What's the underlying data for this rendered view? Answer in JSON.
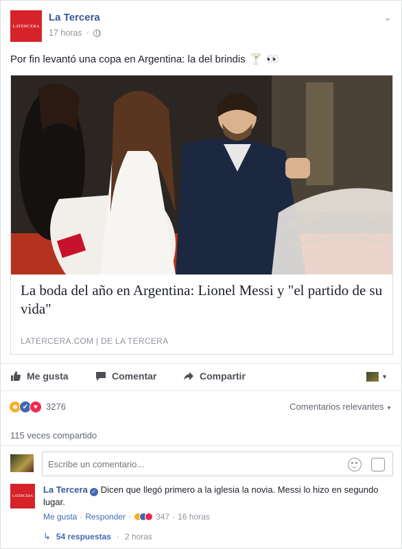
{
  "post": {
    "page_name": "La Tercera",
    "logo_text": "LATERCERA",
    "time": "17 horas",
    "separator": "·",
    "text": "Por fin levantó una copa en Argentina: la del brindis",
    "emoji_glass": "🍸",
    "emoji_eyes": "👀"
  },
  "preview": {
    "title": "La boda del año en Argentina: Lionel Messi y \"el partido de su vida\"",
    "domain": "LATERCERA.COM",
    "divider": "|",
    "by": "DE",
    "by_page": "LA TERCERA"
  },
  "actions": {
    "like": "Me gusta",
    "comment": "Comentar",
    "share": "Compartir"
  },
  "reactions": {
    "count": "3276",
    "sort": "Comentarios relevantes",
    "shares": "115 veces compartido"
  },
  "composer": {
    "placeholder": "Escribe un comentario..."
  },
  "comment": {
    "author": "La Tercera",
    "text": "Dicen que llegó primero a la iglesia la novia. Messi lo hizo en segundo lugar.",
    "like": "Me gusta",
    "reply": "Responder",
    "dot": "·",
    "reaction_count": "347",
    "time": "16 horas",
    "replies": "54 respuestas",
    "replies_time": "2 horas"
  },
  "colors": {
    "brand_red": "#d6232a",
    "fb_blue": "#4267b2",
    "link_blue": "#365899"
  }
}
